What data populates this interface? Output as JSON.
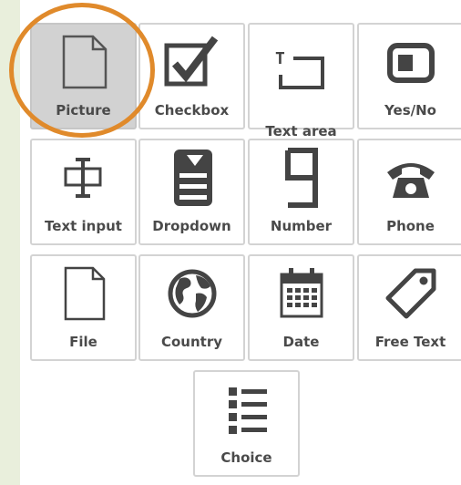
{
  "palette": {
    "icon_color": "#444444",
    "selection_ring_color": "#e08a2b",
    "selected_tile_bg": "#d2d2d2",
    "left_strip_bg": "#e9efdc"
  },
  "field_types": [
    {
      "label": "Picture",
      "icon": "blank-page-icon",
      "selected": true
    },
    {
      "label": "Checkbox",
      "icon": "checkbox-icon"
    },
    {
      "label": "Text area",
      "icon": "text-area-icon"
    },
    {
      "label": "Yes/No",
      "icon": "toggle-icon"
    },
    {
      "label": "Text input",
      "icon": "text-cursor-icon"
    },
    {
      "label": "Dropdown",
      "icon": "dropdown-icon"
    },
    {
      "label": "Number",
      "icon": "digit-nine-icon"
    },
    {
      "label": "Phone",
      "icon": "telephone-icon"
    },
    {
      "label": "File",
      "icon": "file-icon"
    },
    {
      "label": "Country",
      "icon": "globe-icon"
    },
    {
      "label": "Date",
      "icon": "calendar-icon"
    },
    {
      "label": "Free Text",
      "icon": "tag-icon"
    },
    {
      "label": "Choice",
      "icon": "list-icon"
    }
  ]
}
